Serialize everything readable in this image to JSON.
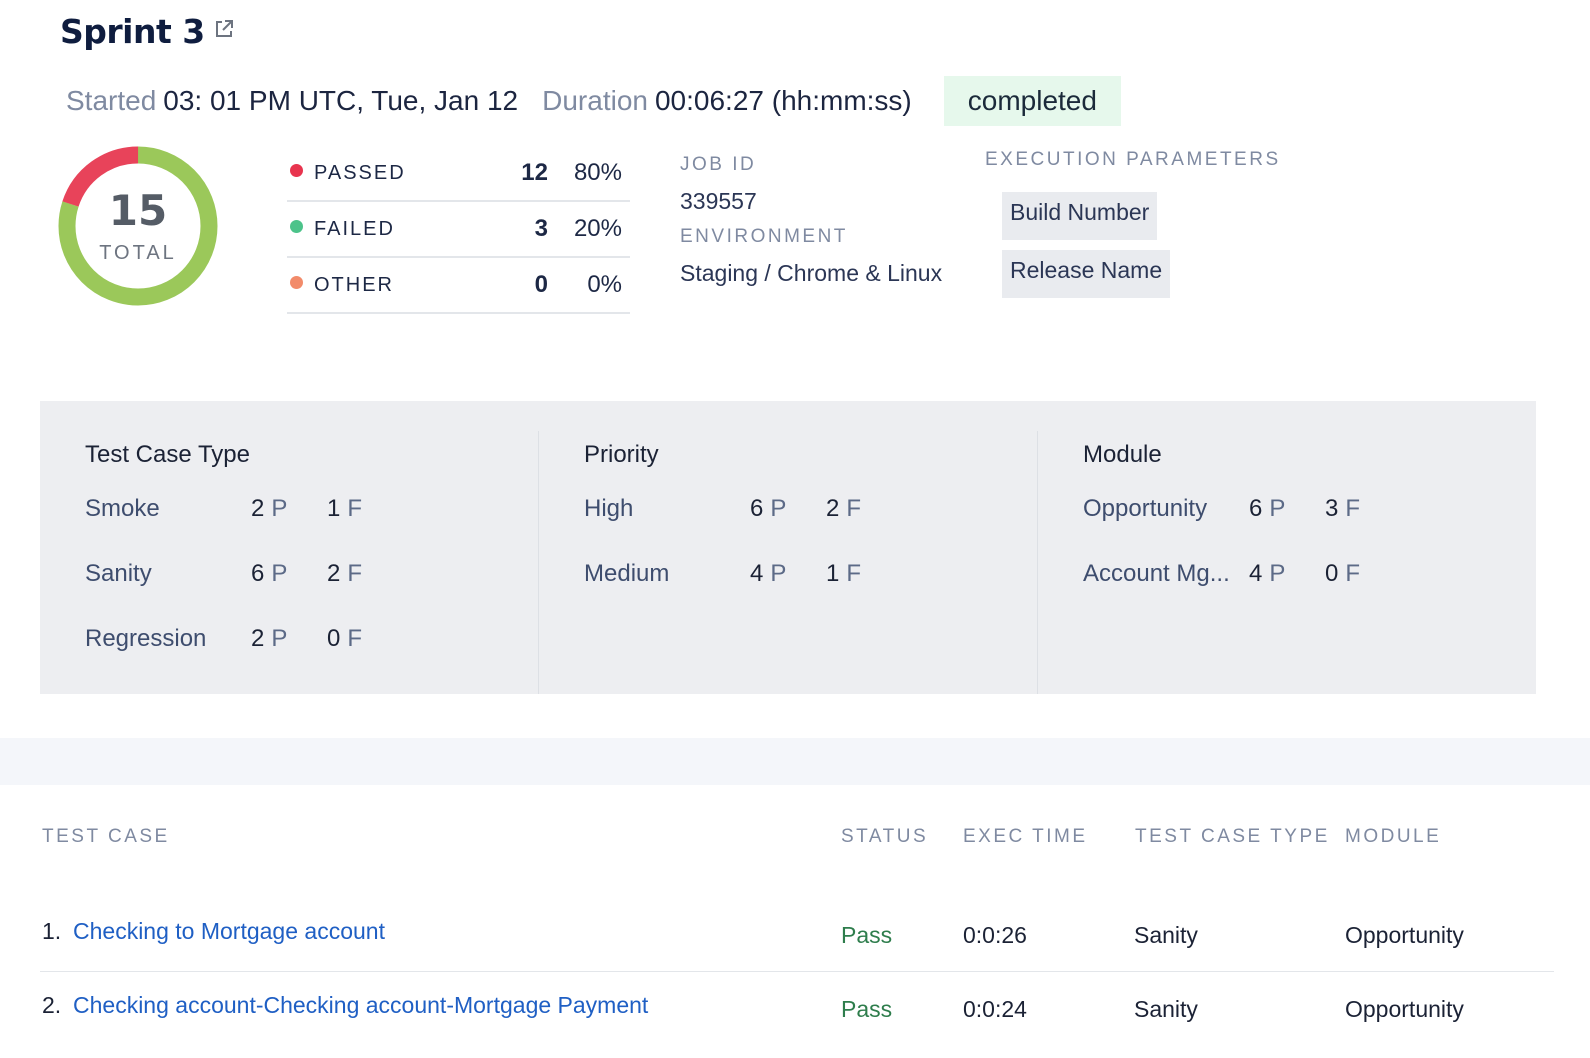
{
  "header": {
    "title": "Sprint 3",
    "started_label": "Started",
    "started_value": "03: 01 PM UTC, Tue, Jan 12",
    "duration_label": "Duration",
    "duration_value": "00:06:27 (hh:mm:ss)",
    "status": "completed"
  },
  "summary": {
    "total": "15",
    "total_label": "TOTAL",
    "rows": [
      {
        "label": "PASSED",
        "count": "12",
        "percent": "80%",
        "color": "#e8344e"
      },
      {
        "label": "FAILED",
        "count": "3",
        "percent": "20%",
        "color": "#4cc38a"
      },
      {
        "label": "OTHER",
        "count": "0",
        "percent": "0%",
        "color": "#f28b6a"
      }
    ],
    "ring": {
      "passed_fraction": 0.8,
      "failed_fraction": 0.2,
      "passed_color": "#9bc85a",
      "failed_color": "#e8435a"
    }
  },
  "info": {
    "job_id_label": "JOB ID",
    "job_id": "339557",
    "environment_label": "ENVIRONMENT",
    "environment": "Staging / Chrome & Linux"
  },
  "execution": {
    "label": "EXECUTION PARAMETERS",
    "params": [
      "Build Number",
      "Release Name"
    ]
  },
  "breakdown": [
    {
      "title": "Test Case Type",
      "rows": [
        {
          "name": "Smoke",
          "p": "2",
          "f": "1"
        },
        {
          "name": "Sanity",
          "p": "6",
          "f": "2"
        },
        {
          "name": "Regression",
          "p": "2",
          "f": "0"
        }
      ]
    },
    {
      "title": "Priority",
      "rows": [
        {
          "name": "High",
          "p": "6",
          "f": "2"
        },
        {
          "name": "Medium",
          "p": "4",
          "f": "1"
        }
      ]
    },
    {
      "title": "Module",
      "rows": [
        {
          "name": "Opportunity",
          "p": "6",
          "f": "3"
        },
        {
          "name": "Account Mg...",
          "p": "4",
          "f": "0"
        }
      ]
    }
  ],
  "suffix": {
    "p": "P",
    "f": "F"
  },
  "table": {
    "headers": [
      "TEST CASE",
      "STATUS",
      "EXEC TIME",
      "TEST CASE TYPE",
      "MODULE"
    ],
    "rows": [
      {
        "index": "1.",
        "name": "Checking to Mortgage account",
        "status": "Pass",
        "time": "0:0:26",
        "type": "Sanity",
        "module": "Opportunity"
      },
      {
        "index": "2.",
        "name": "Checking account-Checking account-Mortgage Payment",
        "status": "Pass",
        "time": "0:0:24",
        "type": "Sanity",
        "module": "Opportunity"
      }
    ]
  }
}
